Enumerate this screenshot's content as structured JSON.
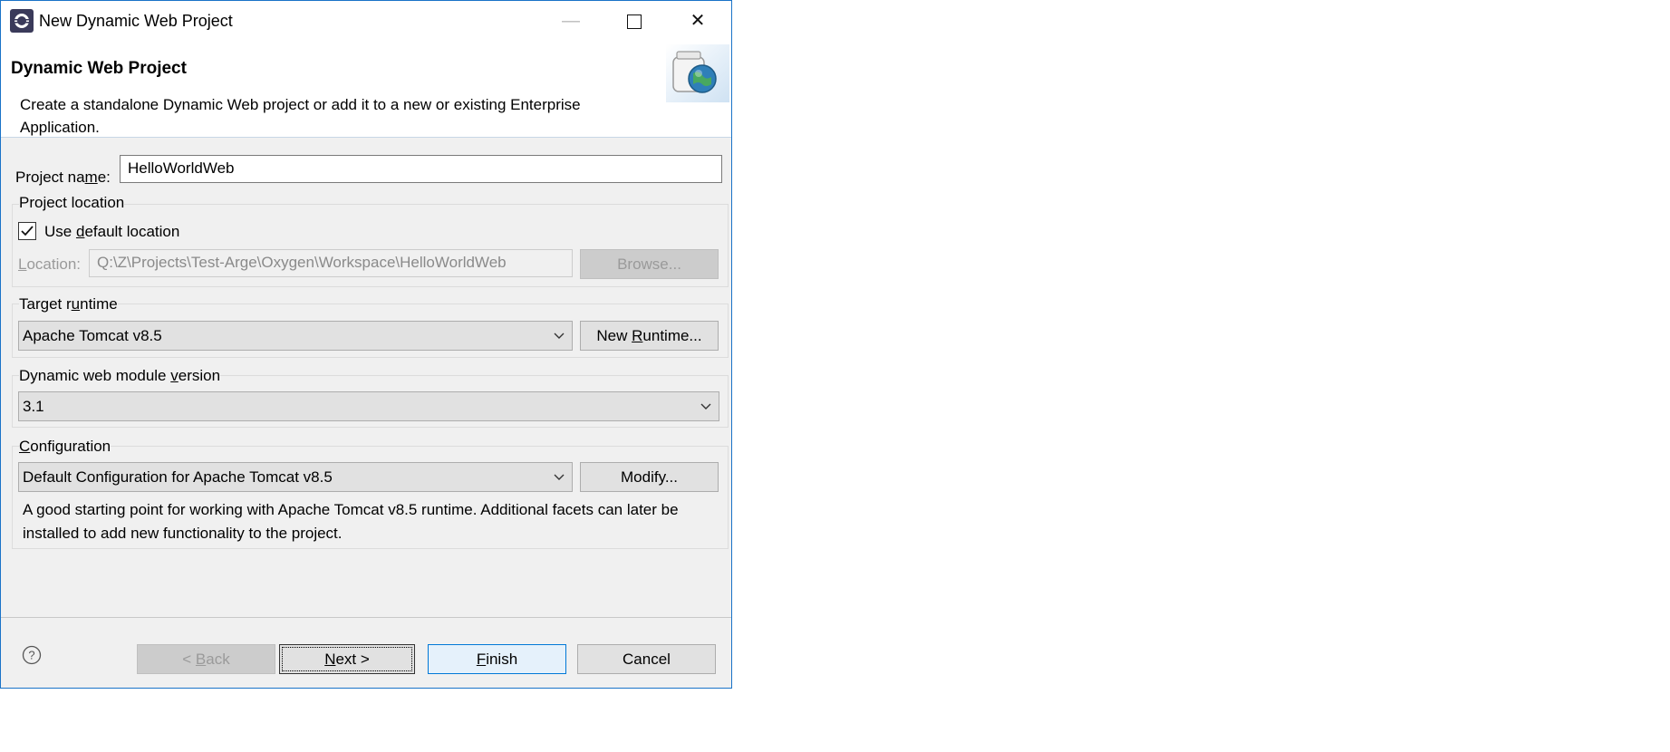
{
  "window": {
    "title": "New Dynamic Web Project",
    "minimize_label": "—",
    "close_label": "✕"
  },
  "header": {
    "title": "Dynamic Web Project",
    "description": "Create a standalone Dynamic Web project or add it to a new or existing Enterprise Application."
  },
  "project_name": {
    "label_pre": "Project na",
    "label_mnemonic": "m",
    "label_post": "e:",
    "value": "HelloWorldWeb"
  },
  "project_location": {
    "group_title": "Project location",
    "use_default": {
      "label_pre": "Use ",
      "label_mnemonic": "d",
      "label_post": "efault location",
      "checked": true
    },
    "location_label_mnemonic": "L",
    "location_label_post": "ocation:",
    "location_value": "Q:\\Z\\Projects\\Test-Arge\\Oxygen\\Workspace\\HelloWorldWeb",
    "browse_label": "Browse..."
  },
  "target_runtime": {
    "group_title_pre": "Target r",
    "group_title_mnemonic": "u",
    "group_title_post": "ntime",
    "selected": "Apache Tomcat v8.5",
    "new_runtime_pre": "New ",
    "new_runtime_mnemonic": "R",
    "new_runtime_post": "untime..."
  },
  "module_version": {
    "group_title_pre": "Dynamic web module ",
    "group_title_mnemonic": "v",
    "group_title_post": "ersion",
    "selected": "3.1"
  },
  "configuration": {
    "group_title_mnemonic": "C",
    "group_title_post": "onfiguration",
    "selected": "Default Configuration for Apache Tomcat v8.5",
    "modify_pre": "Modify",
    "modify_mnemonic": "",
    "modify_post": "...",
    "description": "A good starting point for working with Apache Tomcat v8.5 runtime. Additional facets can later be installed to add new functionality to the project."
  },
  "footer": {
    "help_label": "?",
    "back_pre": "< ",
    "back_mnemonic": "B",
    "back_post": "ack",
    "next_mnemonic": "N",
    "next_post": "ext >",
    "finish_mnemonic": "F",
    "finish_post": "inish",
    "cancel_label": "Cancel"
  },
  "colors": {
    "dialog_border": "#1a73c8",
    "dialog_bg": "#f0f0f0",
    "default_button_bg": "#e5f1fb",
    "default_button_border": "#0078d7"
  }
}
